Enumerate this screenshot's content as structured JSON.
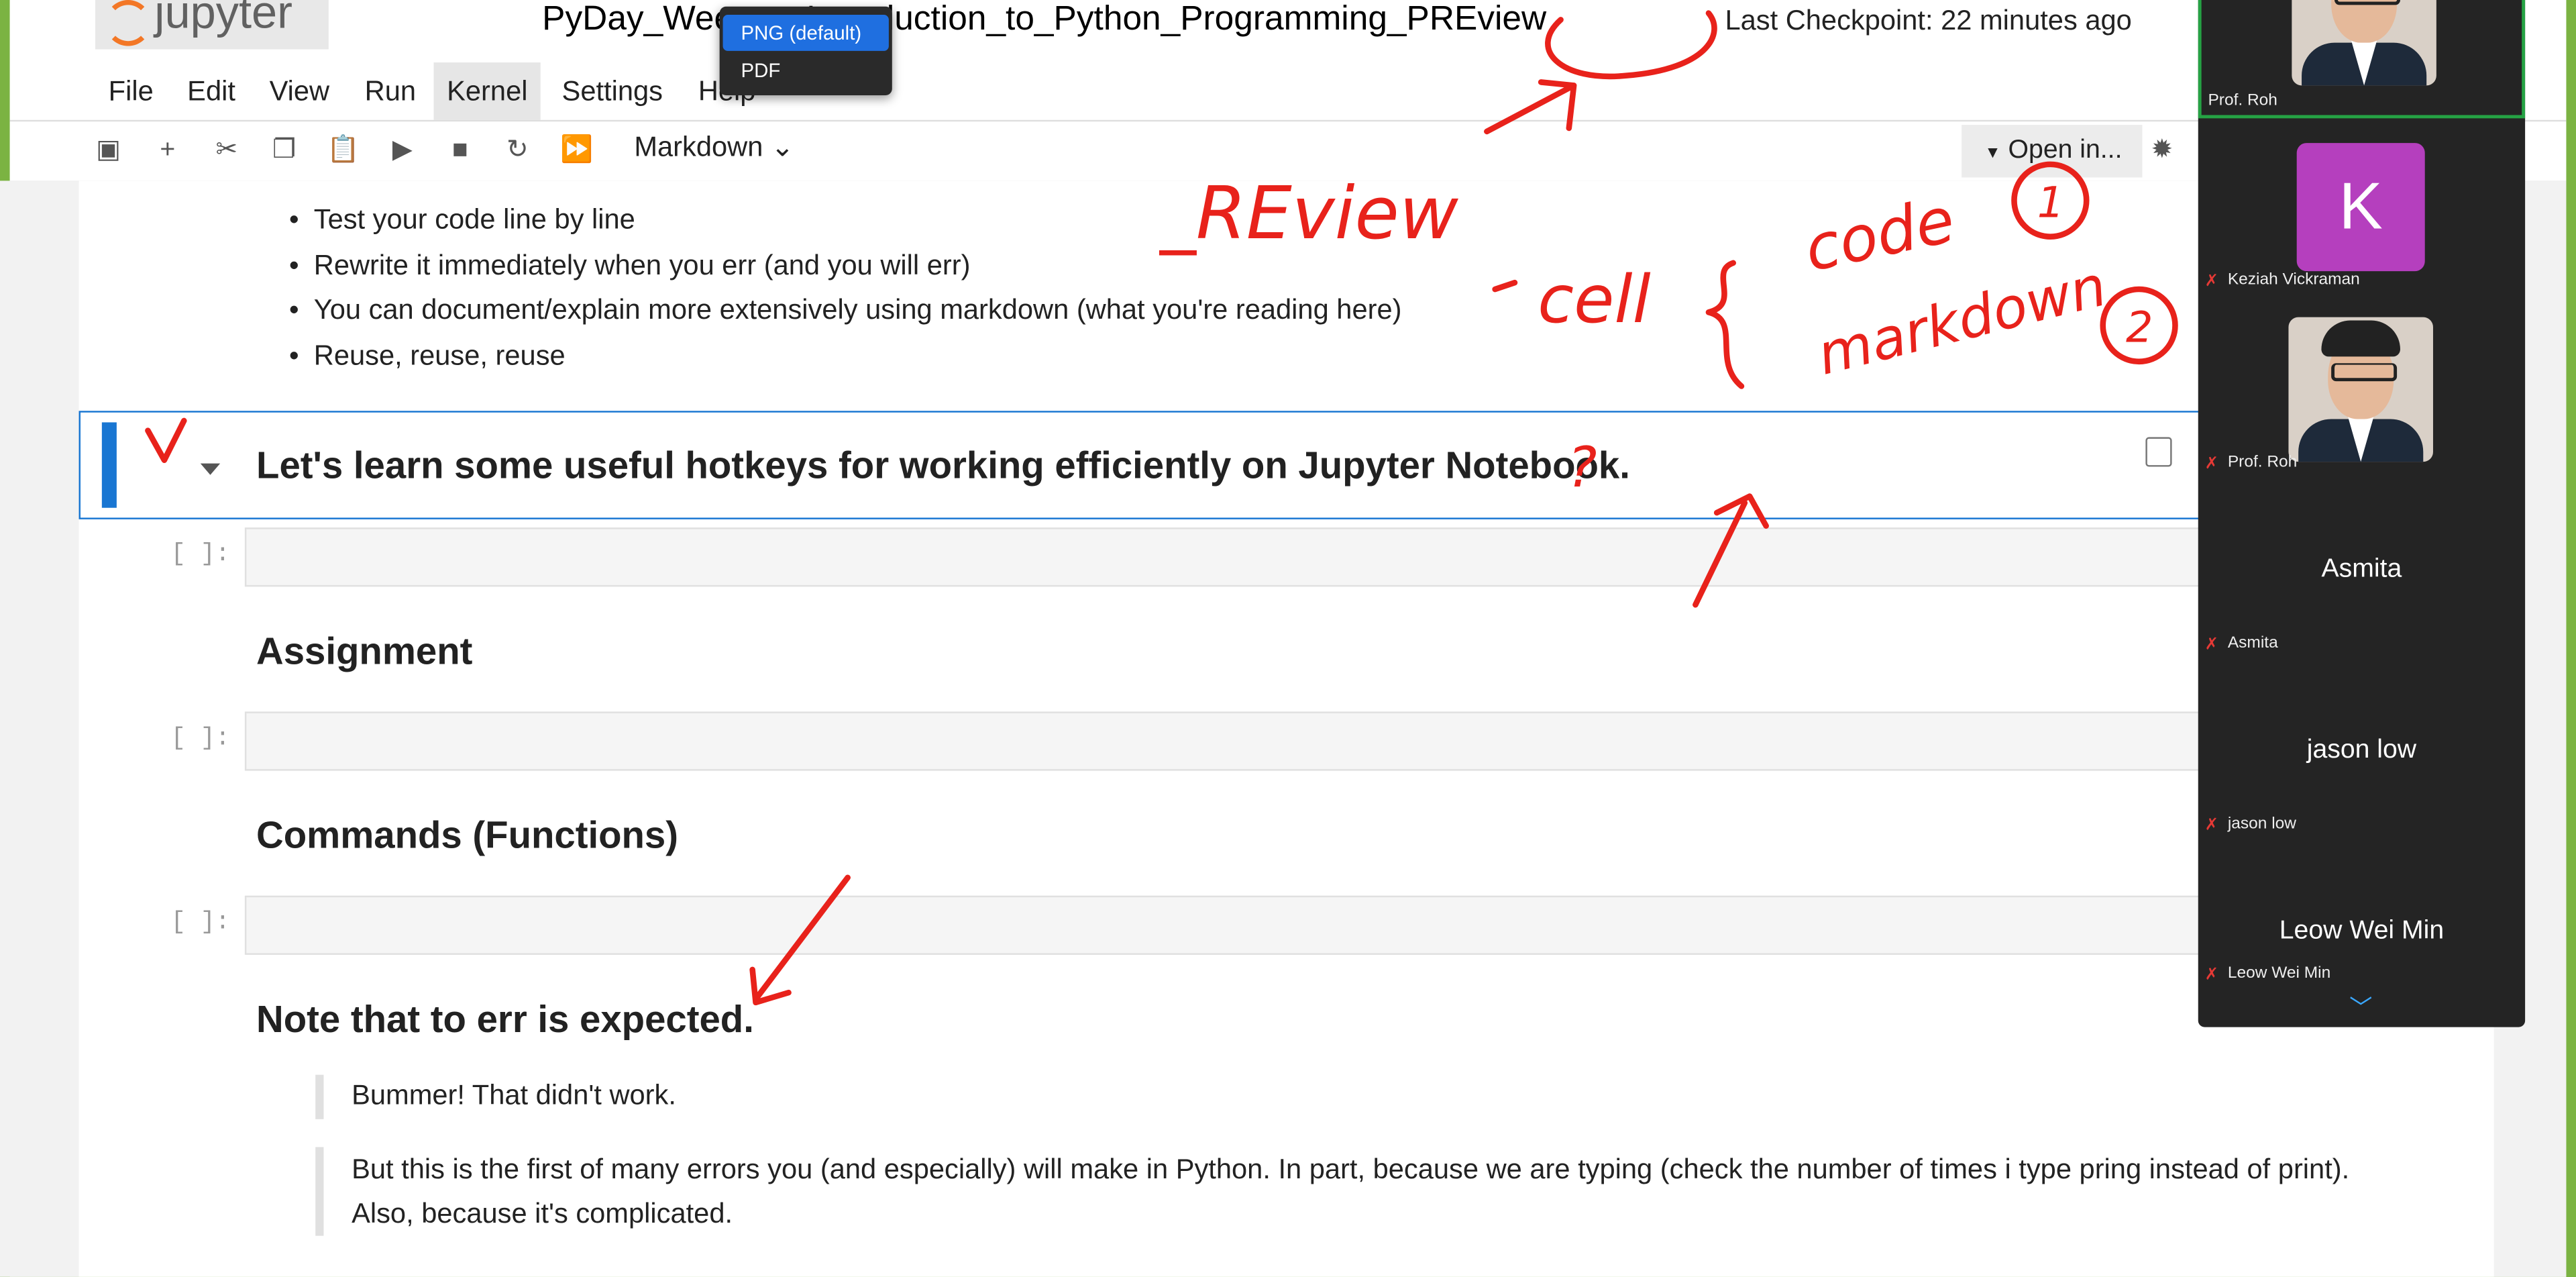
{
  "app": {
    "logo_text": "jupyter",
    "notebook_title": "PyDay_Wee…e_Introduction_to_Python_Programming_PREview",
    "checkpoint": "Last Checkpoint: 22 minutes ago"
  },
  "menu": {
    "items": [
      "File",
      "Edit",
      "View",
      "Run",
      "Kernel",
      "Settings",
      "Help"
    ]
  },
  "toolbar": {
    "cell_type": "Markdown",
    "open_in": "Open in..."
  },
  "dropdown": {
    "items": [
      "PNG (default)",
      "PDF"
    ]
  },
  "bullets": [
    "Test your code line by line",
    "Rewrite it immediately when you err (and you will err)",
    "You can document/explain more extensively using markdown (what you're reading here)",
    "Reuse, reuse, reuse"
  ],
  "cells": {
    "active_heading": "Let's learn some useful hotkeys for working efficiently on Jupyter Notebook.",
    "prompt": "[ ]:",
    "h_assignment": "Assignment",
    "h_commands": "Commands (Functions)",
    "h_note": "Note that to err is expected.",
    "quote1": "Bummer! That didn't work.",
    "quote2": "But this is the first of many errors you (and especially) will make in Python. In part, because we are typing (check the number of times i type pring instead of print). Also, because it's complicated."
  },
  "participants": [
    {
      "name": "Prof. Roh",
      "type": "video"
    },
    {
      "name": "Keziah Vickraman",
      "type": "avatar",
      "initial": "K"
    },
    {
      "name": "Prof. Roh",
      "type": "video"
    },
    {
      "name": "Asmita",
      "type": "name"
    },
    {
      "name": "jason low",
      "type": "name"
    },
    {
      "name": "Leow Wei Min",
      "type": "name"
    }
  ],
  "annotations": {
    "review": "_REview",
    "cell": "cell",
    "code": "code",
    "markdown": "markdown",
    "num1": "1",
    "num2": "2"
  },
  "colors": {
    "accent": "#1976d2",
    "ink": "#e8221b",
    "frame": "#7bb342",
    "zoom_bg": "#242424"
  }
}
